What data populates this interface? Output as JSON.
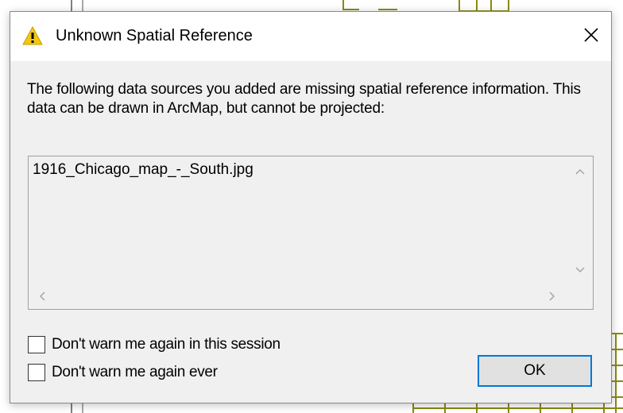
{
  "dialog": {
    "title": "Unknown Spatial Reference",
    "title_icon": "warning-icon",
    "close_icon": "close-icon",
    "message": "The following data sources you added are missing spatial reference information. This data can be drawn in ArcMap, but cannot be projected:",
    "list_items": [
      "1916_Chicago_map_-_South.jpg"
    ],
    "checkboxes": [
      {
        "label": "Don't warn me again in this session",
        "checked": false
      },
      {
        "label": "Don't warn me again ever",
        "checked": false
      }
    ],
    "ok_label": "OK"
  },
  "colors": {
    "accent": "#0078d7",
    "map_lines": "#8a8a14",
    "warning": "#f2c811"
  }
}
